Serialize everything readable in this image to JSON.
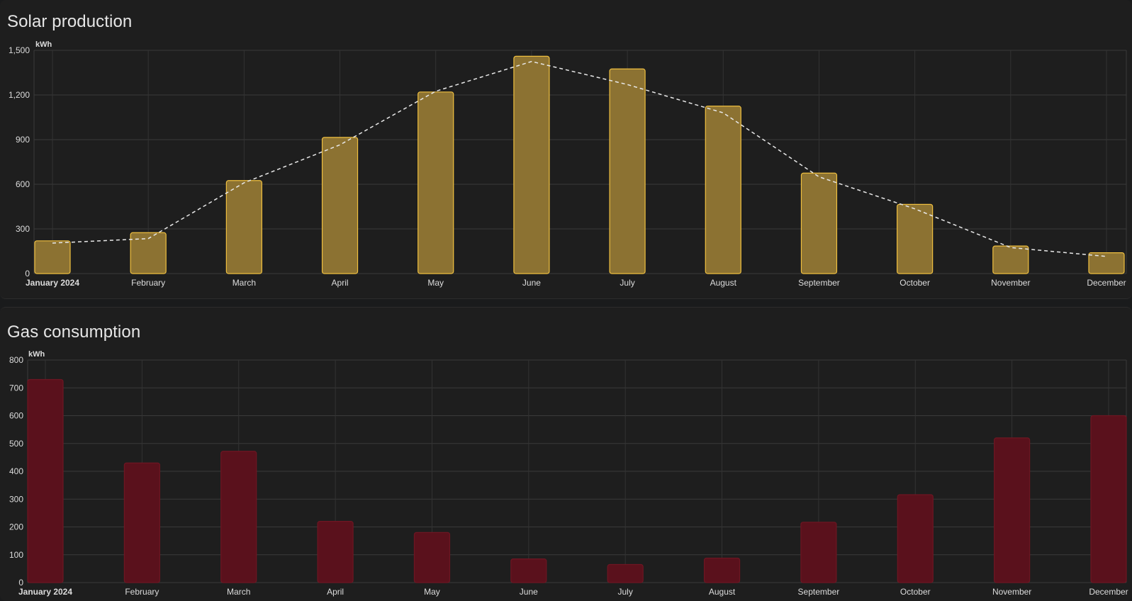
{
  "cards": [
    {
      "title": "Solar production",
      "chart_data": {
        "type": "bar",
        "unit": "kWh",
        "categories": [
          "January 2024",
          "February",
          "March",
          "April",
          "May",
          "June",
          "July",
          "August",
          "September",
          "October",
          "November",
          "December"
        ],
        "series": [
          {
            "type": "bar",
            "values": [
              220,
              275,
              625,
              915,
              1220,
              1460,
              1375,
              1125,
              675,
              465,
              185,
              140
            ],
            "color": "#8c7232",
            "border": "#f0c040"
          },
          {
            "type": "line",
            "style": "dashed",
            "values": [
              205,
              235,
              610,
              865,
              1225,
              1425,
              1270,
              1080,
              650,
              435,
              175,
              115
            ],
            "color": "#e8e8e8"
          }
        ],
        "ylim": [
          0,
          1500
        ],
        "yticks": [
          0,
          300,
          600,
          900,
          1200,
          1500
        ],
        "yticklabels": [
          "0",
          "300",
          "600",
          "900",
          "1,200",
          "1,500"
        ],
        "grid": true
      }
    },
    {
      "title": "Gas consumption",
      "chart_data": {
        "type": "bar",
        "unit": "kWh",
        "categories": [
          "January 2024",
          "February",
          "March",
          "April",
          "May",
          "June",
          "July",
          "August",
          "September",
          "October",
          "November",
          "December"
        ],
        "series": [
          {
            "type": "bar",
            "values": [
              730,
              430,
              472,
              220,
              180,
              85,
              65,
              88,
              217,
              316,
              520,
              600
            ],
            "color": "#5a111c",
            "border": "#6e1622"
          }
        ],
        "ylim": [
          0,
          800
        ],
        "yticks": [
          0,
          100,
          200,
          300,
          400,
          500,
          600,
          700,
          800
        ],
        "yticklabels": [
          "0",
          "100",
          "200",
          "300",
          "400",
          "500",
          "600",
          "700",
          "800"
        ],
        "grid": true
      }
    }
  ]
}
